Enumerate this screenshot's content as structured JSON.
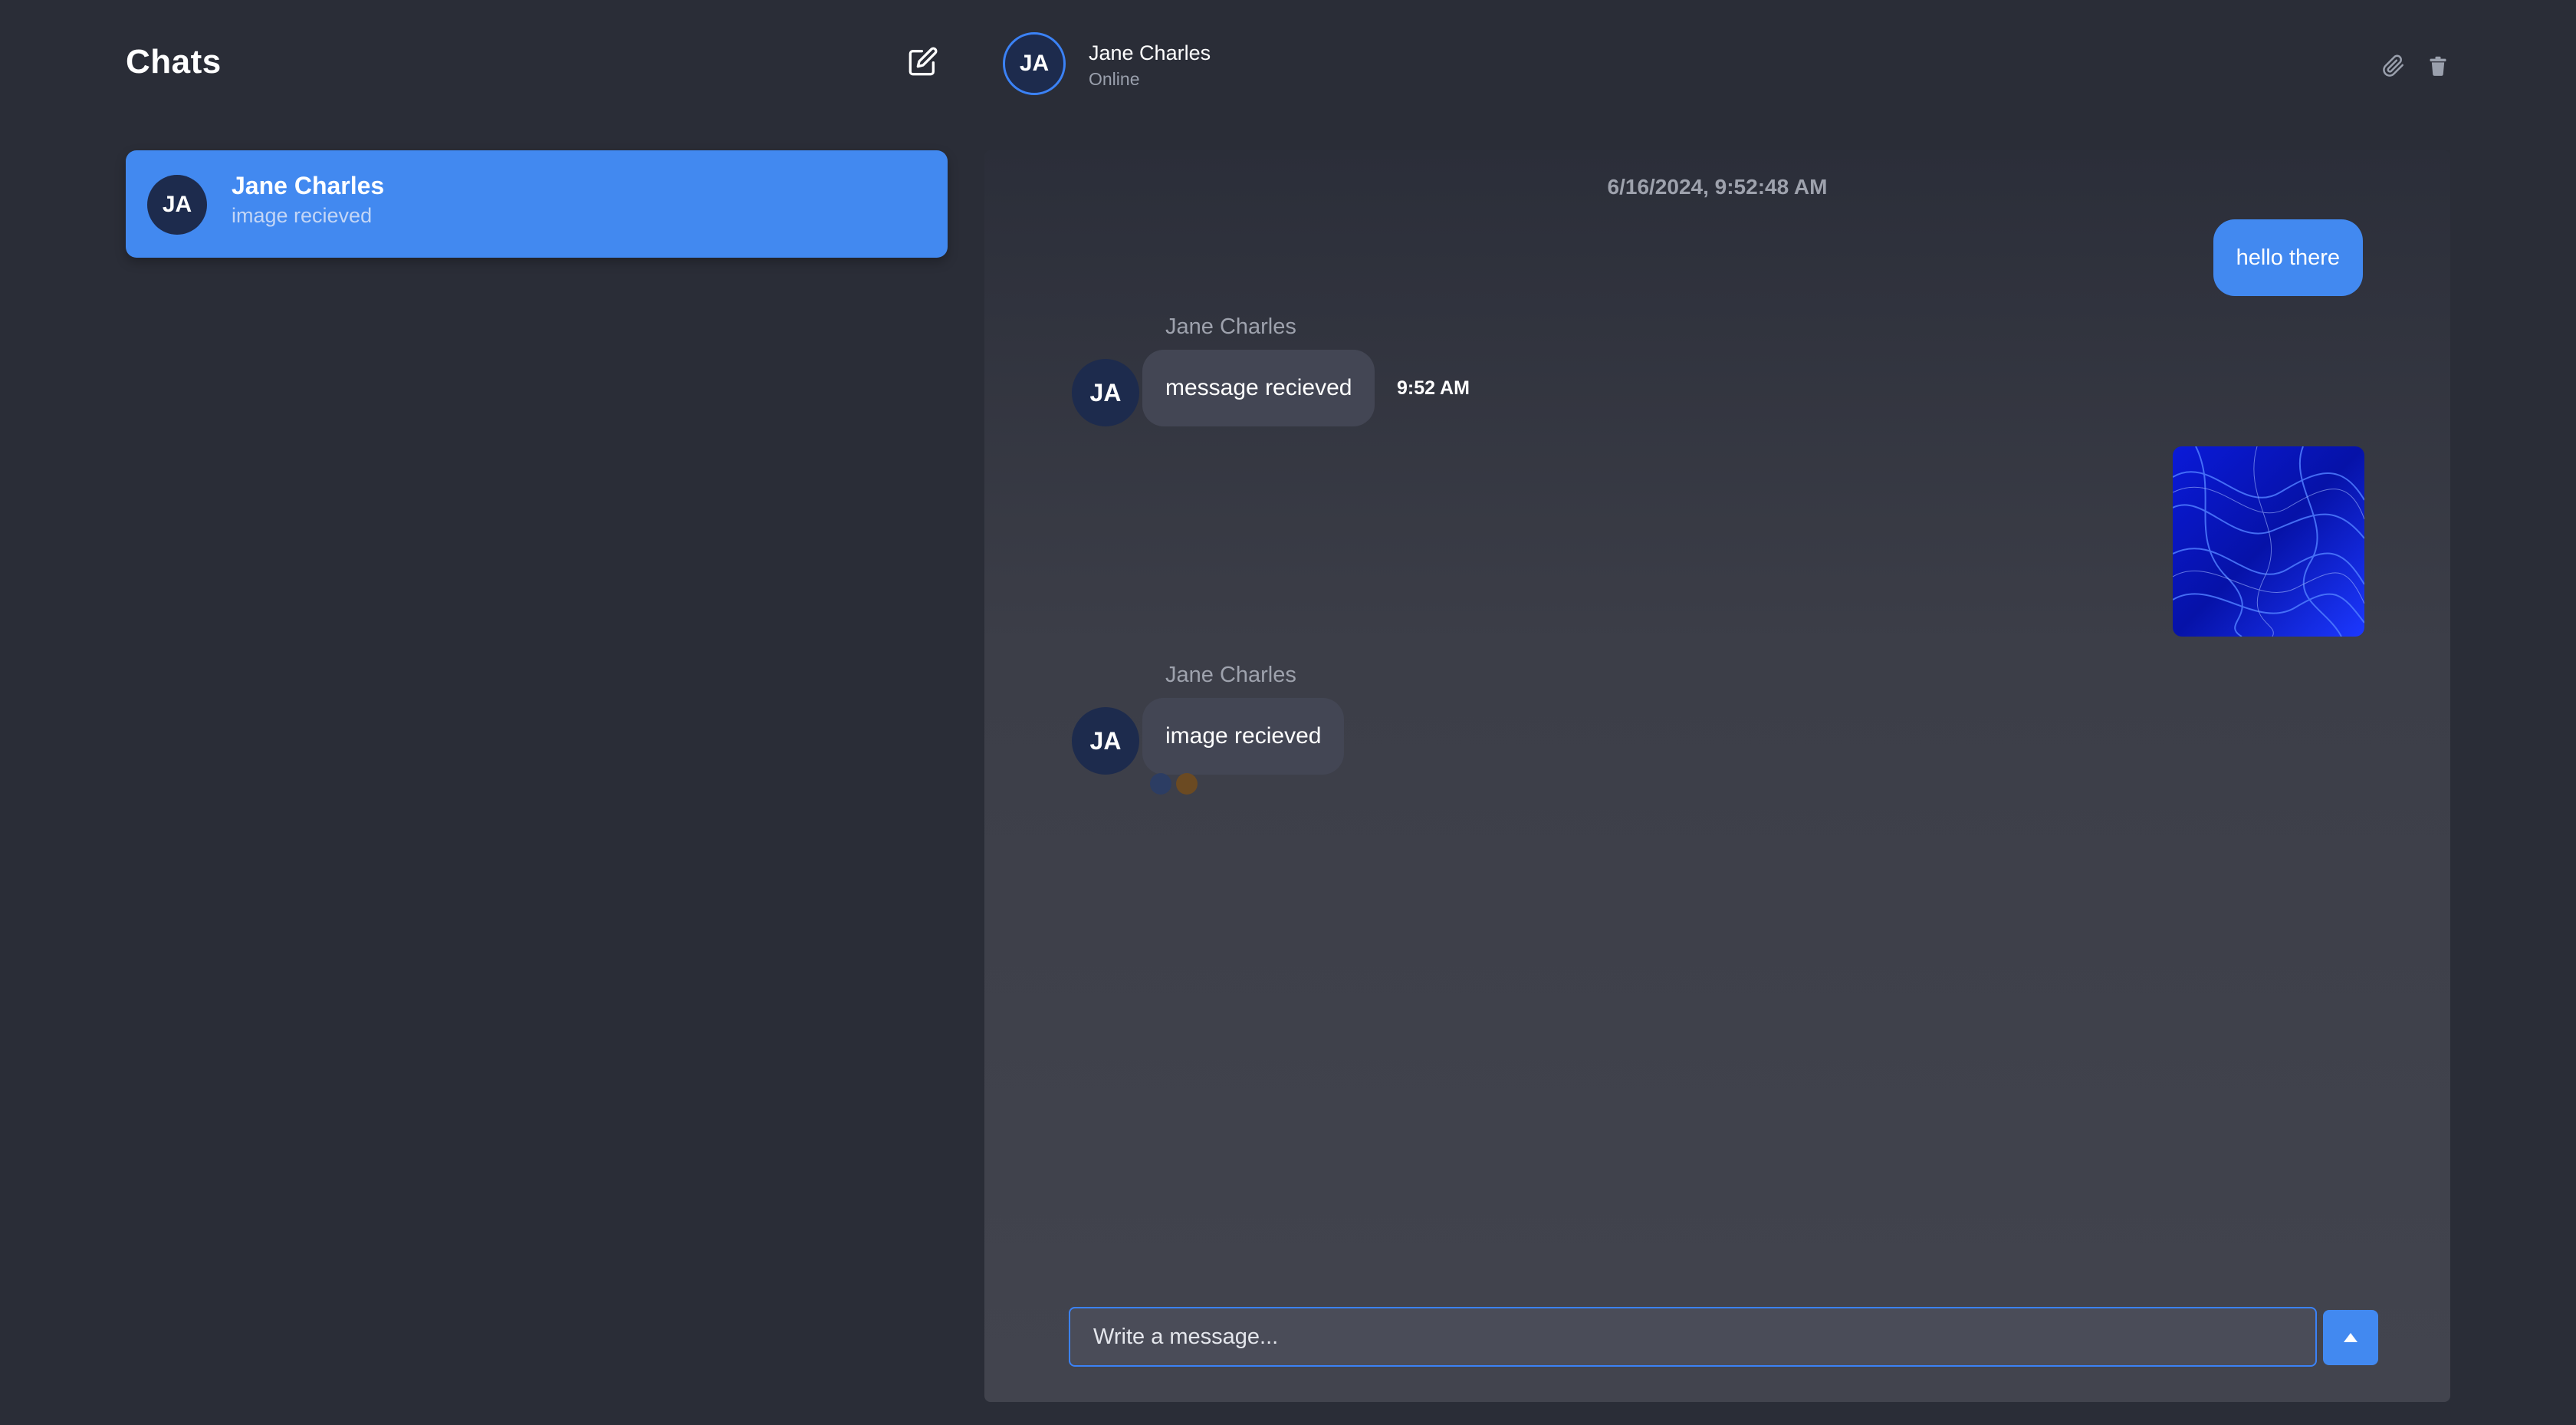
{
  "sidebar": {
    "title": "Chats",
    "compose_icon": "edit-icon",
    "chats": [
      {
        "initials": "JA",
        "name": "Jane Charles",
        "preview": "image recieved",
        "selected": true
      }
    ]
  },
  "header": {
    "initials": "JA",
    "name": "Jane Charles",
    "status": "Online",
    "actions": [
      "paperclip-icon",
      "trash-icon"
    ]
  },
  "conversation": {
    "date": "6/16/2024, 9:52:48 AM",
    "messages": [
      {
        "direction": "out",
        "type": "text",
        "text": "hello there"
      },
      {
        "direction": "in",
        "sender": "Jane Charles",
        "initials": "JA",
        "type": "text",
        "text": "message recieved",
        "time": "9:52 AM"
      },
      {
        "direction": "out",
        "type": "image",
        "image": "blue-abstract-swirl"
      },
      {
        "direction": "in",
        "sender": "Jane Charles",
        "initials": "JA",
        "type": "text",
        "text": "image recieved"
      }
    ]
  },
  "composer": {
    "placeholder": "Write a message...",
    "value": "",
    "send_icon": "triangle-up-icon"
  },
  "colors": {
    "background": "#2a2d37",
    "accent": "#4289f0",
    "avatar_bg": "#1d2b4d",
    "incoming_bubble": "#434654"
  }
}
